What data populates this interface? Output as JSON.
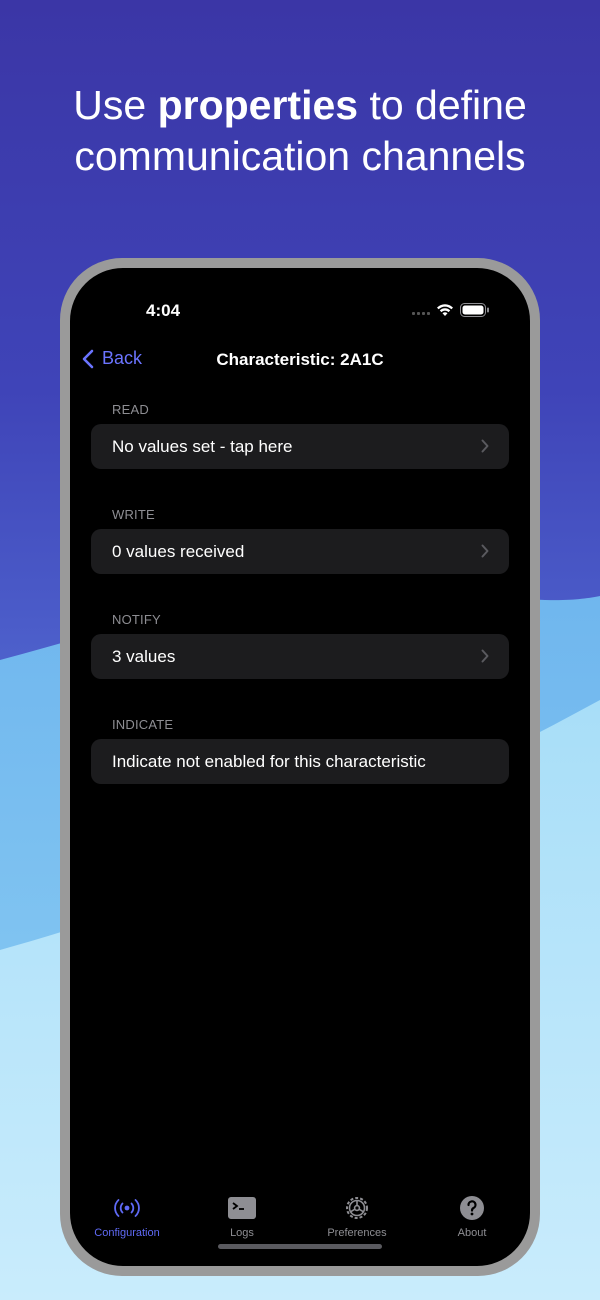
{
  "headline": {
    "prefix": "Use",
    "bold": "properties",
    "suffix": "to define",
    "line2": "communication channels"
  },
  "status": {
    "time": "4:04"
  },
  "nav": {
    "back_label": "Back",
    "title": "Characteristic: 2A1C"
  },
  "sections": [
    {
      "label": "READ",
      "value": "No values set - tap here",
      "chevron": true
    },
    {
      "label": "WRITE",
      "value": "0 values received",
      "chevron": true
    },
    {
      "label": "NOTIFY",
      "value": "3 values",
      "chevron": true
    },
    {
      "label": "INDICATE",
      "value": "Indicate not enabled for this characteristic",
      "chevron": false
    }
  ],
  "tabs": [
    {
      "label": "Configuration",
      "icon": "broadcast-icon",
      "active": true
    },
    {
      "label": "Logs",
      "icon": "terminal-icon",
      "active": false
    },
    {
      "label": "Preferences",
      "icon": "gear-icon",
      "active": false
    },
    {
      "label": "About",
      "icon": "question-icon",
      "active": false
    }
  ],
  "colors": {
    "accent": "#5f6af5",
    "cell_bg": "#1c1c1e",
    "background_top": "#3b36a6",
    "wave_light": "#8fd0f4"
  }
}
